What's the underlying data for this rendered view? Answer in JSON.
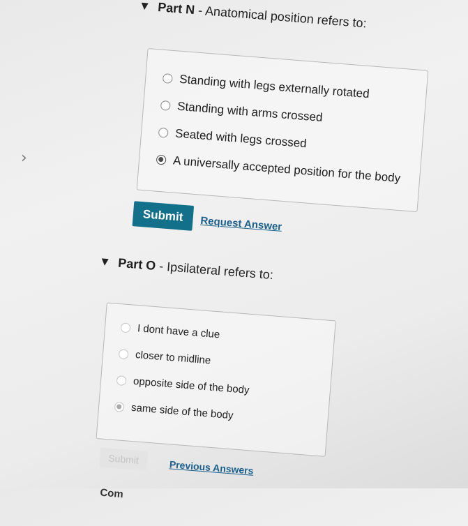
{
  "nav": {
    "back_glyph": "›",
    "icon": "chevron-left-icon"
  },
  "part_n": {
    "label": "Part N",
    "separator": "-",
    "question": "Anatomical position refers to:",
    "options": [
      {
        "label": "Standing with legs externally rotated",
        "selected": false
      },
      {
        "label": "Standing with arms crossed",
        "selected": false
      },
      {
        "label": "Seated with legs crossed",
        "selected": false
      },
      {
        "label": "A universally accepted position for the body",
        "selected": true
      }
    ],
    "submit_label": "Submit",
    "request_answer_label": "Request Answer"
  },
  "part_o": {
    "label": "Part O",
    "separator": "-",
    "question": "Ipsilateral refers to:",
    "options": [
      {
        "label": "I dont have a clue",
        "selected": false
      },
      {
        "label": "closer to midline",
        "selected": false
      },
      {
        "label": "opposite side of the body",
        "selected": false
      },
      {
        "label": "same side of the body",
        "selected": true
      }
    ],
    "submit_label": "Submit",
    "previous_answers_label": "Previous Answers"
  },
  "cutoff_text": "Com"
}
